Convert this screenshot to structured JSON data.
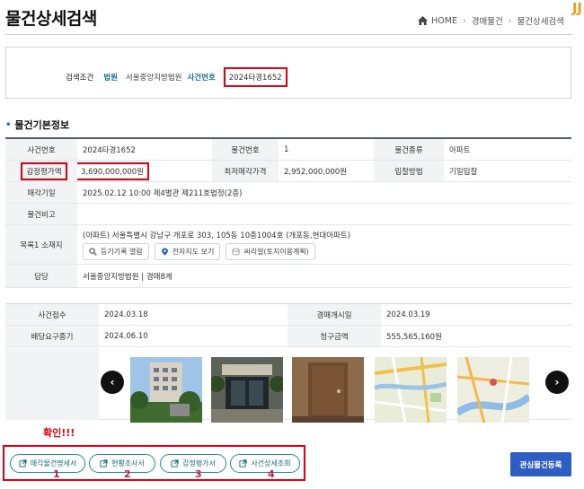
{
  "header": {
    "title": "물건상세검색",
    "breadcrumb": [
      "HOME",
      "경매물건",
      "물건상세검색"
    ],
    "corner_mark": "JJ"
  },
  "search": {
    "label": "검색조건",
    "court_key": "법원",
    "court_value": "서울중앙지방법원",
    "case_key": "사건번호",
    "case_value": "2024타경1652"
  },
  "section": {
    "title": "물건기본정보"
  },
  "info": {
    "case_no_label": "사건번호",
    "case_no": "2024타경1652",
    "item_no_label": "물건번호",
    "item_no": "1",
    "item_type_label": "물건종류",
    "item_type": "아파트",
    "appraisal_label": "감정평가액",
    "appraisal": "3,690,000,000원",
    "min_price_label": "최저매각가격",
    "min_price": "2,952,000,000원",
    "bid_method_label": "입찰방법",
    "bid_method": "기일입찰",
    "sale_date_label": "매각기일",
    "sale_date": "2025.02.12 10:00 제4별관 제211호법정(2층)",
    "note_label": "물건비고",
    "note": "",
    "location_label": "목록1 소재지",
    "location": "(아파트) 서울특별시 강남구 개포로 303, 105동 10층1004호 (개포동,현대아파트)",
    "loc_buttons": [
      "등기기록 열람",
      "전자지도 보기",
      "씨리얼(토지이용계획)"
    ],
    "dept_label": "담당",
    "dept": "서울중앙지방법원 | 경매8계"
  },
  "info2": {
    "received_label": "사건접수",
    "received": "2024.03.18",
    "auction_start_label": "경매개시일",
    "auction_start": "2024.03.19",
    "dividend_label": "배당요구종기",
    "dividend": "2024.06.10",
    "claim_label": "청구금액",
    "claim": "555,565,160원"
  },
  "annotation": {
    "confirm": "확인!!!",
    "numbers": [
      "1",
      "2",
      "3",
      "4"
    ]
  },
  "doc_buttons": [
    "매각물건명세서",
    "현황조사서",
    "감정평가서",
    "사건상세조회"
  ],
  "favorite_button": "관심물건등록",
  "colors": {
    "accent": "#2e5ec4",
    "teal": "#1d8c8c",
    "highlight": "#e60012"
  }
}
